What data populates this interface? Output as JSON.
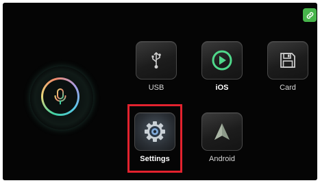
{
  "colors": {
    "background": "#050505",
    "link_button": "#47b54b",
    "highlight": "#e3222e",
    "ios_accent": "#4fd88a"
  },
  "top_bar": {
    "link_icon": "link-icon"
  },
  "voice": {
    "icon": "microphone-icon"
  },
  "apps": [
    {
      "id": "usb",
      "label": "USB",
      "icon": "usb-icon"
    },
    {
      "id": "ios",
      "label": "iOS",
      "icon": "carplay-play-icon"
    },
    {
      "id": "card",
      "label": "Card",
      "icon": "sd-card-icon"
    },
    {
      "id": "settings",
      "label": "Settings",
      "icon": "gear-icon",
      "highlighted": true
    },
    {
      "id": "android",
      "label": "Android",
      "icon": "android-auto-icon"
    }
  ]
}
